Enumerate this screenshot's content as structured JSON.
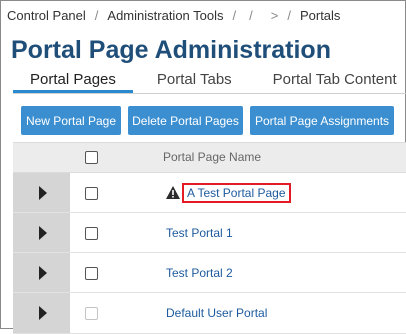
{
  "breadcrumb": {
    "items": [
      "Control Panel",
      "Administration Tools",
      "",
      "",
      "Portals"
    ],
    "separator": "/",
    "gt": ">"
  },
  "page": {
    "title": "Portal Page Administration"
  },
  "tabs": [
    {
      "label": "Portal Pages",
      "active": true
    },
    {
      "label": "Portal Tabs",
      "active": false
    },
    {
      "label": "Portal Tab Content",
      "active": false
    }
  ],
  "toolbar": {
    "new_label": "New Portal Page",
    "delete_label": "Delete Portal Pages",
    "assign_label": "Portal Page Assignments"
  },
  "grid": {
    "header": "Portal Page Name",
    "rows": [
      {
        "name": "A Test Portal Page",
        "warning": true,
        "highlighted": true,
        "checkbox_enabled": true
      },
      {
        "name": "Test Portal 1",
        "warning": false,
        "highlighted": false,
        "checkbox_enabled": true
      },
      {
        "name": "Test Portal 2",
        "warning": false,
        "highlighted": false,
        "checkbox_enabled": true
      },
      {
        "name": "Default User Portal",
        "warning": false,
        "highlighted": false,
        "checkbox_enabled": false
      }
    ]
  },
  "colors": {
    "title": "#1f4e79",
    "button": "#3b8fd0",
    "link": "#1d5a9e",
    "highlight_border": "#e21b25",
    "tab_active_underline": "#2a8ad0"
  },
  "icons": {
    "row_expander": "caret-right-icon",
    "warning": "warning-triangle-icon"
  }
}
